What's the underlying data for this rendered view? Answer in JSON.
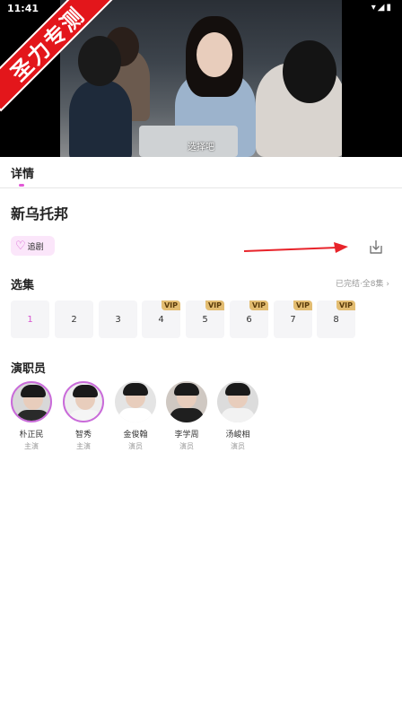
{
  "status_bar": {
    "time": "11:41",
    "icons": "▾◢▮"
  },
  "watermark": {
    "text": "圣力专测"
  },
  "video": {
    "subtitle": "选择吧"
  },
  "tabs": {
    "details_label": "详情"
  },
  "show": {
    "title": "新乌托邦"
  },
  "actions": {
    "follow_label": "追剧",
    "follow_icon": "heart-outline-icon",
    "download_icon": "download-icon"
  },
  "episodes": {
    "section_title": "选集",
    "status_text": "已完结·全8集 ›",
    "items": [
      {
        "label": "1",
        "vip": ""
      },
      {
        "label": "2",
        "vip": ""
      },
      {
        "label": "3",
        "vip": ""
      },
      {
        "label": "4",
        "vip": "VIP"
      },
      {
        "label": "5",
        "vip": "VIP"
      },
      {
        "label": "6",
        "vip": "VIP"
      },
      {
        "label": "7",
        "vip": "VIP"
      },
      {
        "label": "8",
        "vip": "VIP"
      }
    ]
  },
  "cast": {
    "section_title": "演职员",
    "members": [
      {
        "name": "朴正民",
        "role": "主演"
      },
      {
        "name": "智秀",
        "role": "主演"
      },
      {
        "name": "金俊翰",
        "role": "演员"
      },
      {
        "name": "李学周",
        "role": "演员"
      },
      {
        "name": "汤峻相",
        "role": "演员"
      }
    ]
  },
  "colors": {
    "accent": "#d653cf",
    "vip_badge": "#e3bd72",
    "ribbon": "#e3161b",
    "arrow": "#e8232a"
  }
}
